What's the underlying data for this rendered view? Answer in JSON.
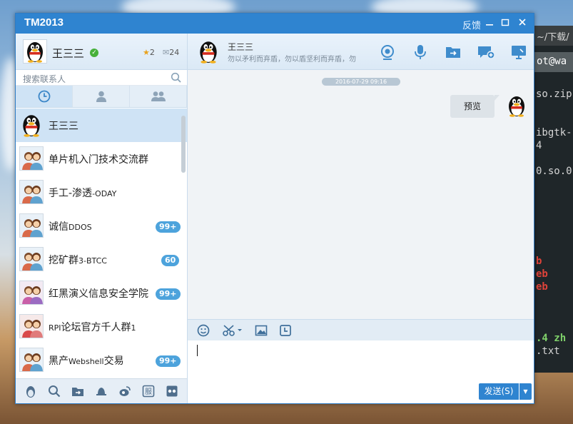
{
  "window": {
    "title": "TM2013",
    "feedback_label": "反馈",
    "colors": {
      "titlebar": "#2f84d0",
      "accent": "#4da3dc",
      "online": "#46b03a"
    }
  },
  "profile": {
    "name": "王三三",
    "stat_messages_count": "2",
    "stat_mail_count": "24"
  },
  "search": {
    "placeholder": "搜索联系人"
  },
  "tabs": [
    {
      "icon": "clock-icon"
    },
    {
      "icon": "person-icon"
    },
    {
      "icon": "group-icon"
    }
  ],
  "contacts": [
    {
      "name": "王三三",
      "suffix": "",
      "badge": ""
    },
    {
      "name": "单片机入门技术交流群",
      "suffix": "",
      "badge": ""
    },
    {
      "name": "手工-渗透",
      "suffix": "-ODAY",
      "badge": ""
    },
    {
      "name": "诚信",
      "suffix": "DDOS",
      "badge": "99+"
    },
    {
      "name": "挖矿群",
      "suffix": "3-BTCC",
      "badge": "60"
    },
    {
      "name": "红黑演义信息安全学院",
      "suffix": "",
      "badge": "99+"
    },
    {
      "name": "论坛官方千人群",
      "prefix": "RPI",
      "suffix": "1",
      "badge": ""
    },
    {
      "name": "黑产",
      "suffix": "交易",
      "mid": "Webshell",
      "badge": "99+"
    }
  ],
  "chat": {
    "contact_name": "王三三",
    "signature": "勿以矛利而弃盾，勿以盾坚利而弃盾，勿",
    "date": "2016-07-29 09:16",
    "message": "预览",
    "send_label": "发送(S)"
  },
  "terminal": {
    "title": "~/下载/",
    "prompt": "ot@wa",
    "lines": [
      "so.zip",
      "ibgtk-",
      "4",
      "0.so.0",
      "b",
      "eb",
      "eb",
      ".4  zh",
      ".txt"
    ]
  }
}
